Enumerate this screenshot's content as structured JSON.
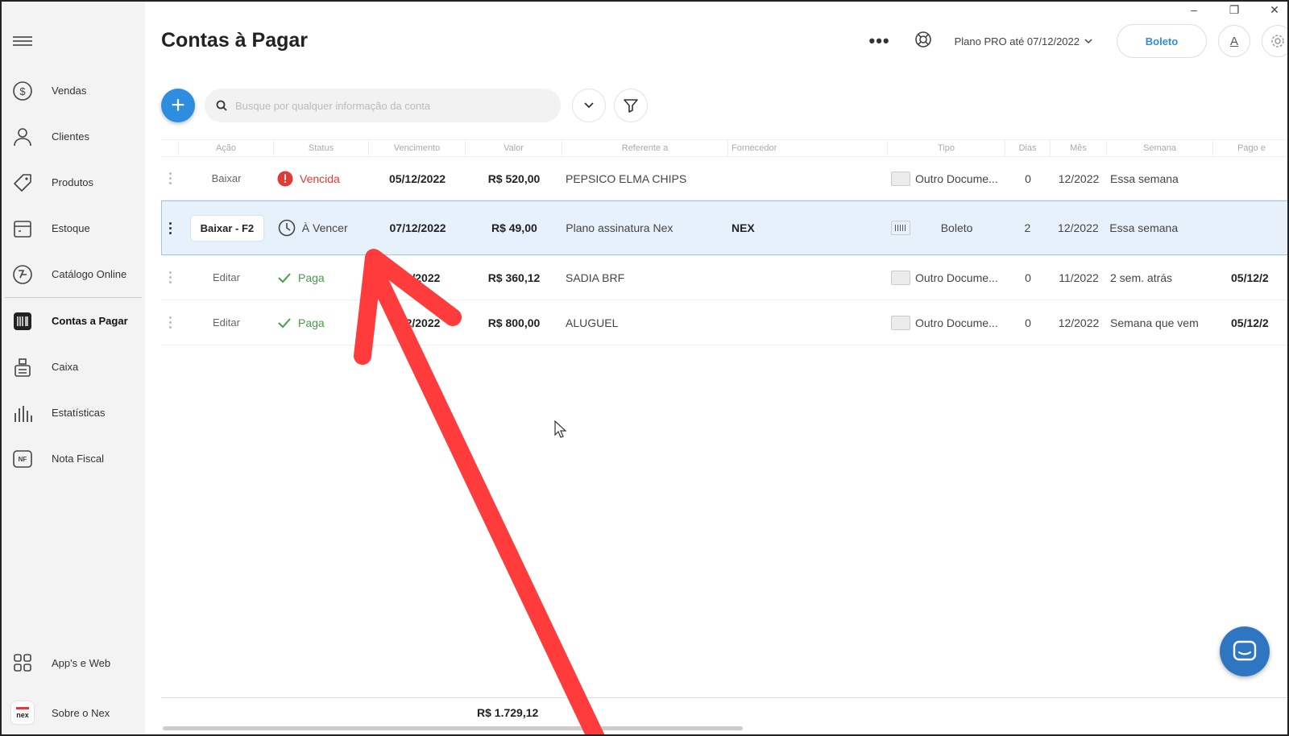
{
  "window": {
    "minimize": "–",
    "restore": "❐",
    "close": "✕"
  },
  "sidebar": {
    "items": [
      {
        "label": "Vendas",
        "icon": "dollar-circle-icon"
      },
      {
        "label": "Clientes",
        "icon": "user-icon"
      },
      {
        "label": "Produtos",
        "icon": "tag-icon"
      },
      {
        "label": "Estoque",
        "icon": "box-icon"
      },
      {
        "label": "Catálogo Online",
        "icon": "catalog-icon"
      },
      {
        "label": "Contas a Pagar",
        "icon": "barcode-icon",
        "active": true
      },
      {
        "label": "Caixa",
        "icon": "cash-register-icon"
      },
      {
        "label": "Estatísticas",
        "icon": "bar-chart-icon"
      },
      {
        "label": "Nota Fiscal",
        "icon": "nf-icon",
        "badge": "NF"
      }
    ],
    "bottom": [
      {
        "label": "App's e Web",
        "icon": "apps-grid-icon"
      },
      {
        "label": "Sobre o Nex",
        "icon": "nex-logo-icon",
        "logo_text": "nex"
      }
    ]
  },
  "header": {
    "title": "Contas à Pagar",
    "more": "•••",
    "plan": "Plano PRO até 07/12/2022",
    "boleto": "Boleto",
    "font_btn": "A"
  },
  "toolbar": {
    "add": "+",
    "search_placeholder": "Busque por qualquer informação da conta"
  },
  "table": {
    "columns": [
      "",
      "Ação",
      "Status",
      "Vencimento",
      "Valor",
      "Referente a",
      "Fornecedor",
      "Tipo",
      "Dias",
      "Mês",
      "Semana",
      "Pago e"
    ],
    "rows": [
      {
        "action": "Baixar",
        "status": "Vencida",
        "status_kind": "overdue",
        "due": "05/12/2022",
        "value": "R$ 520,00",
        "ref": "PEPSICO ELMA CHIPS",
        "supplier": "",
        "type": "Outro Docume...",
        "type_kind": "doc",
        "days": "0",
        "month": "12/2022",
        "week": "Essa semana",
        "paid": ""
      },
      {
        "action": "Baixar - F2",
        "status": "À Vencer",
        "status_kind": "pending",
        "due": "07/12/2022",
        "value": "R$ 49,00",
        "ref": "Plano assinatura Nex",
        "supplier": "NEX",
        "type": "Boleto",
        "type_kind": "boleto",
        "days": "2",
        "month": "12/2022",
        "week": "Essa semana",
        "paid": "",
        "selected": true
      },
      {
        "action": "Editar",
        "status": "Paga",
        "status_kind": "paid",
        "due": "…1/2022",
        "value": "R$ 360,12",
        "ref": "SADIA BRF",
        "supplier": "",
        "type": "Outro Docume...",
        "type_kind": "doc",
        "days": "0",
        "month": "11/2022",
        "week": "2 sem. atrás",
        "paid": "05/12/2"
      },
      {
        "action": "Editar",
        "status": "Paga",
        "status_kind": "paid",
        "due": "…2/2022",
        "value": "R$ 800,00",
        "ref": "ALUGUEL",
        "supplier": "",
        "type": "Outro Docume...",
        "type_kind": "doc",
        "days": "0",
        "month": "12/2022",
        "week": "Semana que vem",
        "paid": "05/12/2"
      }
    ]
  },
  "footer": {
    "total": "R$ 1.729,12"
  },
  "colors": {
    "accent": "#2d8ee0",
    "overdue": "#e53935",
    "paid": "#43a047",
    "annotation": "#ff3b3b",
    "chat": "#2f76c2"
  }
}
